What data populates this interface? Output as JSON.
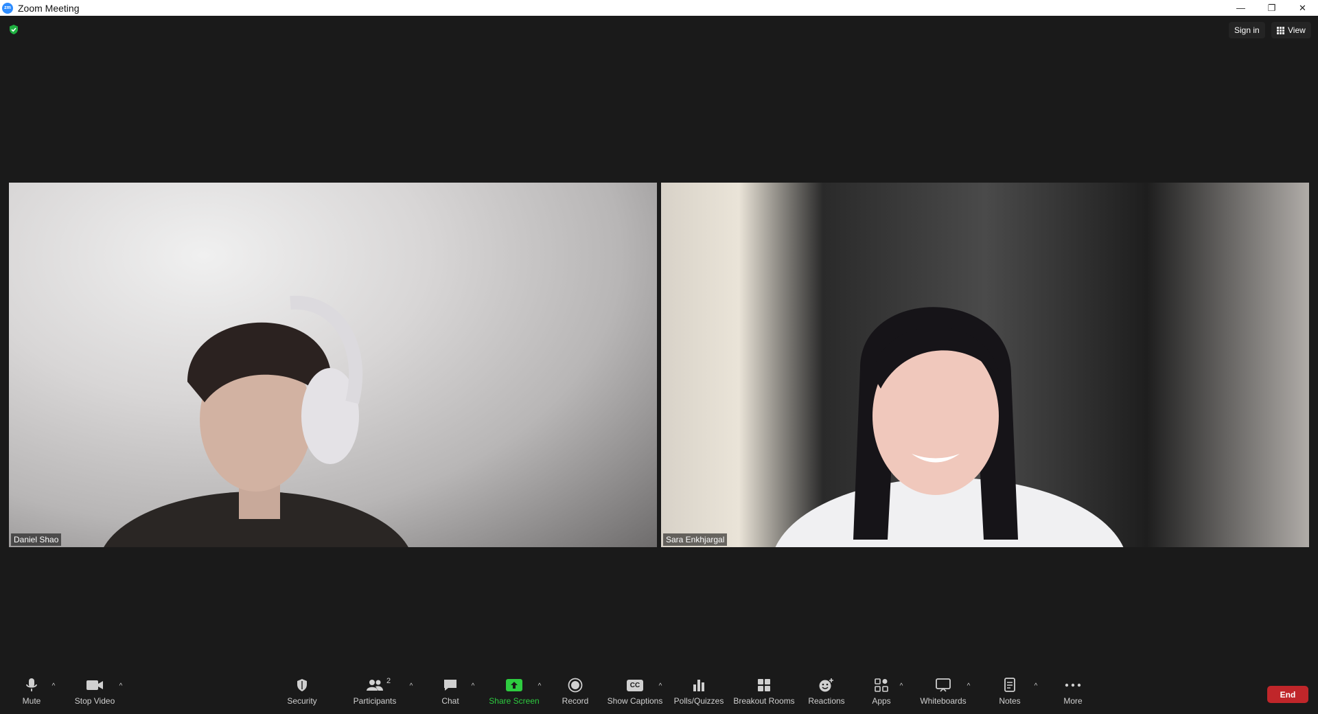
{
  "window": {
    "title": "Zoom Meeting",
    "logo_text": "zm",
    "minimize": "—",
    "restore": "❐",
    "close": "✕"
  },
  "header": {
    "sign_in": "Sign in",
    "view": "View",
    "shield_color": "#1fb141"
  },
  "participants": [
    {
      "name": "Daniel Shao"
    },
    {
      "name": "Sara Enkhjargal"
    }
  ],
  "toolbar": {
    "mute": "Mute",
    "stop_video": "Stop Video",
    "security": "Security",
    "participants": "Participants",
    "participants_count": "2",
    "chat": "Chat",
    "share_screen": "Share Screen",
    "record": "Record",
    "show_captions": "Show Captions",
    "captions_icon_text": "CC",
    "polls": "Polls/Quizzes",
    "breakout_rooms": "Breakout Rooms",
    "reactions": "Reactions",
    "apps": "Apps",
    "whiteboards": "Whiteboards",
    "notes": "Notes",
    "more": "More",
    "end": "End",
    "caret": "^",
    "share_color": "#2ecc40",
    "end_color": "#c0262a"
  }
}
